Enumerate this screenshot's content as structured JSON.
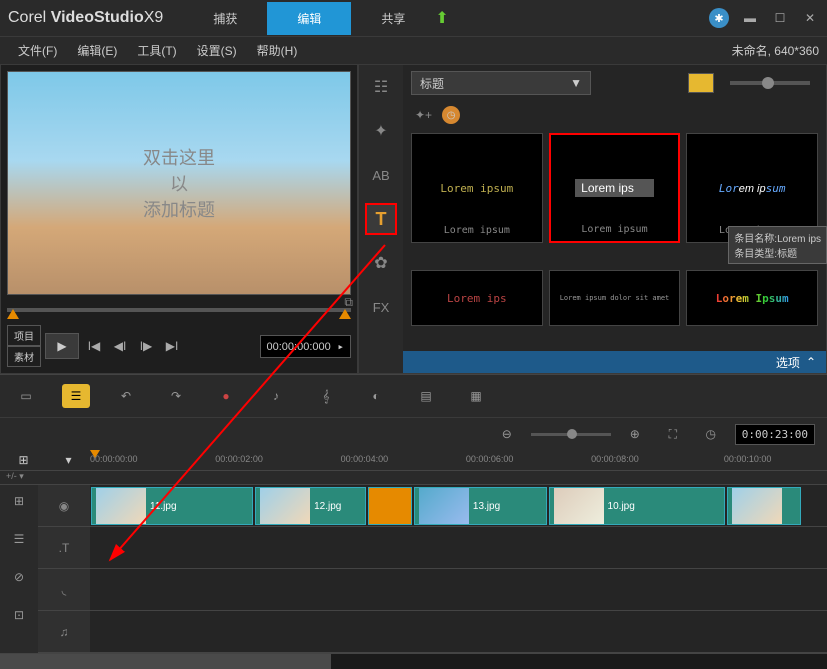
{
  "app": {
    "name_brand": "Corel",
    "name_prod": "VideoStudio",
    "name_ver": "X9"
  },
  "top_tabs": {
    "capture": "捕获",
    "edit": "编辑",
    "share": "共享"
  },
  "project_status": "未命名, 640*360",
  "menu": {
    "file": "文件(F)",
    "edit": "编辑(E)",
    "tools": "工具(T)",
    "settings": "设置(S)",
    "help": "帮助(H)"
  },
  "preview": {
    "overlay_line1": "双击这里",
    "overlay_line2": "以",
    "overlay_line3": "添加标题",
    "tab_project": "项目",
    "tab_clip": "素材",
    "timecode": "00:00:00:000"
  },
  "library": {
    "category": "标题",
    "options_btn": "选项",
    "tooltip_name_label": "条目名称:",
    "tooltip_name_value": "Lorem ips",
    "tooltip_type_label": "条目类型:",
    "tooltip_type_value": "标题",
    "items": [
      {
        "thumb": "Lorem ipsum",
        "cap": "Lorem ipsum"
      },
      {
        "thumb": "Lorem ips",
        "cap": "Lorem ipsum"
      },
      {
        "thumb": "Lorem ipsum",
        "cap": "Lorem ipsum"
      },
      {
        "thumb": "Lorem ips",
        "cap": ""
      },
      {
        "thumb": "Lorem ipsum dolor sit amet",
        "cap": ""
      },
      {
        "thumb": "Lorem Ipsum",
        "cap": ""
      }
    ],
    "side_tools": {
      "t_label": "T",
      "ab_label": "AB",
      "fx_label": "FX"
    }
  },
  "timeline": {
    "duration": "0:00:23:00",
    "ruler": [
      "00:00:00:00",
      "00:00:02:00",
      "00:00:04:00",
      "00:00:06:00",
      "00:00:08:00",
      "00:00:10:00"
    ],
    "clips": [
      {
        "name": "11.jpg"
      },
      {
        "name": "12.jpg"
      },
      {
        "name": "13.jpg"
      },
      {
        "name": "10.jpg"
      }
    ]
  }
}
